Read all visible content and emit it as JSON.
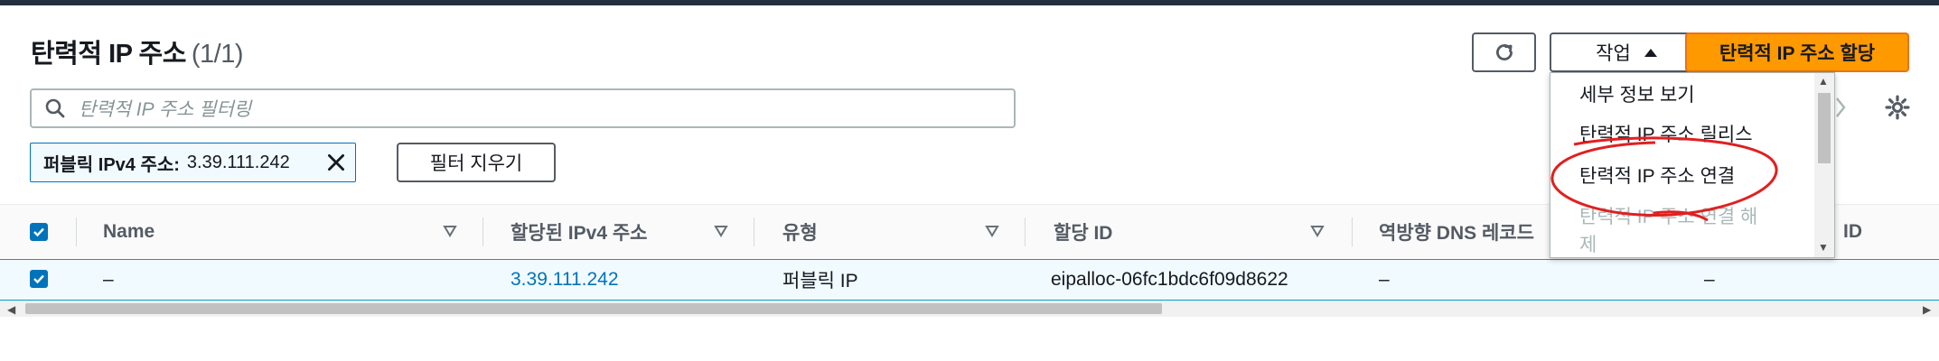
{
  "header": {
    "title": "탄력적 IP 주소",
    "count": "(1/1)",
    "actions_label": "작업",
    "allocate_label": "탄력적 IP 주소 할당"
  },
  "search": {
    "placeholder": "탄력적 IP 주소 필터링"
  },
  "filter_token": {
    "key": "퍼블릭 IPv4 주소:",
    "value": "3.39.111.242"
  },
  "clear_filters_label": "필터 지우기",
  "table": {
    "columns": [
      "Name",
      "할당된 IPv4 주소",
      "유형",
      "할당 ID",
      "역방향 DNS 레코드",
      "ID"
    ],
    "row": {
      "name": "–",
      "ipv4": "3.39.111.242",
      "type": "퍼블릭 IP",
      "allocation_id": "eipalloc-06fc1bdc6f09d8622",
      "reverse_dns": "–",
      "last": "–"
    }
  },
  "actions_menu": {
    "items": [
      "세부 정보 보기",
      "탄력적 IP 주소 릴리스",
      "탄력적 IP 주소 연결",
      "탄력적 IP 주소 연결 해",
      "제"
    ]
  },
  "colors": {
    "primary": "#ff9900",
    "link": "#0073bb",
    "annotation": "#e02020"
  },
  "icons": [
    "refresh-icon",
    "caret-up-icon",
    "search-icon",
    "close-icon",
    "gear-icon",
    "chevron-right-icon",
    "sort-icon",
    "checkbox-checked-icon"
  ]
}
